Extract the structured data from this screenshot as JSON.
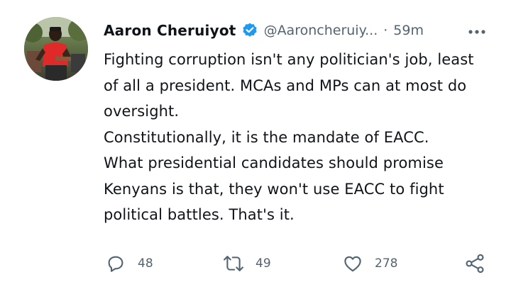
{
  "author": {
    "display_name": "Aaron Cheruiyot",
    "handle": "@Aaroncheruiy...",
    "separator": "·",
    "time": "59m",
    "verified": true,
    "verified_color": "#1d9bf0"
  },
  "tweet": {
    "lines": [
      "Fighting corruption isn't any politician's job, least",
      "of all a president. MCAs and MPs can at most do",
      "oversight.",
      "Constitutionally, it is the mandate of EACC.",
      "What presidential candidates should promise",
      "Kenyans is that, they won't use EACC to fight",
      "political battles. That's it."
    ]
  },
  "actions": {
    "reply_count": "48",
    "retweet_count": "49",
    "like_count": "278"
  },
  "icons": {
    "more": "more-horizontal-icon",
    "reply": "reply-icon",
    "retweet": "retweet-icon",
    "like": "heart-icon",
    "share": "share-icon"
  },
  "colors": {
    "text": "#0f1419",
    "secondary": "#536471",
    "icon": "#536471"
  }
}
